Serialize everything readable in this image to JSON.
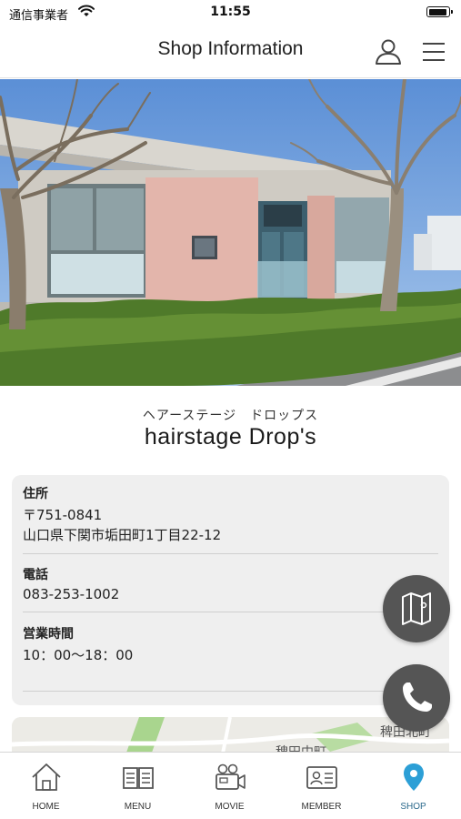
{
  "status_bar": {
    "carrier": "通信事業者",
    "time": "11:55",
    "battery_level": 0.95
  },
  "header": {
    "title": "Shop Information",
    "user_icon": "user-icon",
    "menu_icon": "hamburger-menu-icon"
  },
  "shop": {
    "name_kana": "ヘアーステージ　ドロップス",
    "name": "hairstage Drop's"
  },
  "info": {
    "address_label": "住所",
    "postal_code": "〒751-0841",
    "address": "山口県下関市垢田町1丁目22-12",
    "phone_label": "電話",
    "phone": "083-253-1002",
    "hours_label": "営業時間",
    "hours": "10：00〜18：00"
  },
  "map": {
    "labels": [
      "稗田北町",
      "稗田中町"
    ]
  },
  "fabs": {
    "map_icon": "map-icon",
    "call_icon": "phone-icon"
  },
  "tabs": [
    {
      "label": "HOME",
      "icon": "home-icon"
    },
    {
      "label": "MENU",
      "icon": "book-icon"
    },
    {
      "label": "MOVIE",
      "icon": "video-camera-icon"
    },
    {
      "label": "MEMBER",
      "icon": "member-card-icon"
    },
    {
      "label": "SHOP",
      "icon": "location-pin-icon"
    }
  ],
  "colors": {
    "accent": "#2c9fd6",
    "fab": "#555555",
    "card": "#efefef"
  }
}
